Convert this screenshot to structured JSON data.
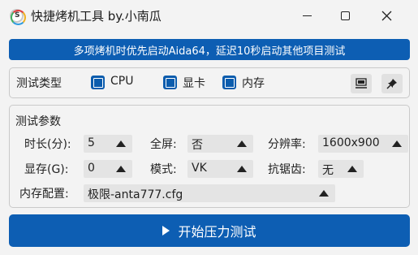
{
  "window": {
    "title": "快捷烤机工具 by.小南瓜",
    "icon": "app-logo-icon",
    "icon_letter": "S"
  },
  "banner": {
    "text": "多项烤机时优先启动Aida64，延迟10秒启动其他项目测试"
  },
  "test_type": {
    "label": "测试类型",
    "options": [
      {
        "label": "CPU",
        "checked": true
      },
      {
        "label": "显卡",
        "checked": true
      },
      {
        "label": "内存",
        "checked": true
      }
    ],
    "icons": [
      "monitor-icon",
      "pin-icon"
    ]
  },
  "params": {
    "label": "测试参数",
    "duration": {
      "label": "时长(分):",
      "value": "5"
    },
    "fullscreen": {
      "label": "全屏:",
      "value": "否"
    },
    "resolution": {
      "label": "分辨率:",
      "value": "1600x900"
    },
    "vram": {
      "label": "显存(G):",
      "value": "0"
    },
    "mode": {
      "label": "模式:",
      "value": "VK"
    },
    "antialias": {
      "label": "抗锯齿:",
      "value": "无"
    },
    "memory_config": {
      "label": "内存配置:",
      "value": "极限-anta777.cfg"
    }
  },
  "start_button": {
    "label": "开始压力测试"
  },
  "colors": {
    "accent": "#0d5eb3",
    "field_bg": "#e4e4e4"
  }
}
